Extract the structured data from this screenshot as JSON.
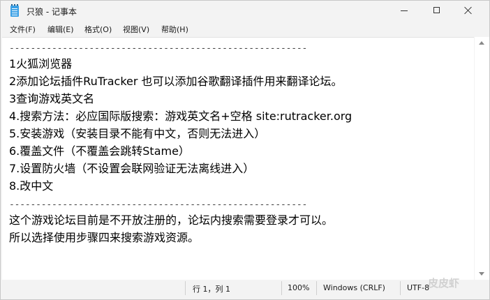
{
  "window": {
    "title": "只狼 - 记事本"
  },
  "menu": [
    "文件(F)",
    "编辑(E)",
    "格式(O)",
    "视图(V)",
    "帮助(H)"
  ],
  "document": {
    "lines": [
      "--------------------------------------------------------",
      "1火狐浏览器",
      "2添加论坛插件RuTracker 也可以添加谷歌翻译插件用来翻译论坛。",
      "3查询游戏英文名",
      "4.搜索方法：必应国际版搜索：游戏英文名+空格 site:rutracker.org",
      "5.安装游戏（安装目录不能有中文，否则无法进入）",
      "6.覆盖文件（不覆盖会跳转Stame）",
      "7.设置防火墙（不设置会联网验证无法离线进入）",
      "8.改中文",
      "--------------------------------------------------------",
      "这个游戏论坛目前是不开放注册的，论坛内搜索需要登录才可以。",
      "所以选择使用步骤四来搜索游戏资源。"
    ]
  },
  "status": {
    "position": "行 1，列 1",
    "zoom": "100%",
    "line_ending": "Windows (CRLF)",
    "encoding": "UTF-8"
  },
  "watermark": "皮皮虾"
}
